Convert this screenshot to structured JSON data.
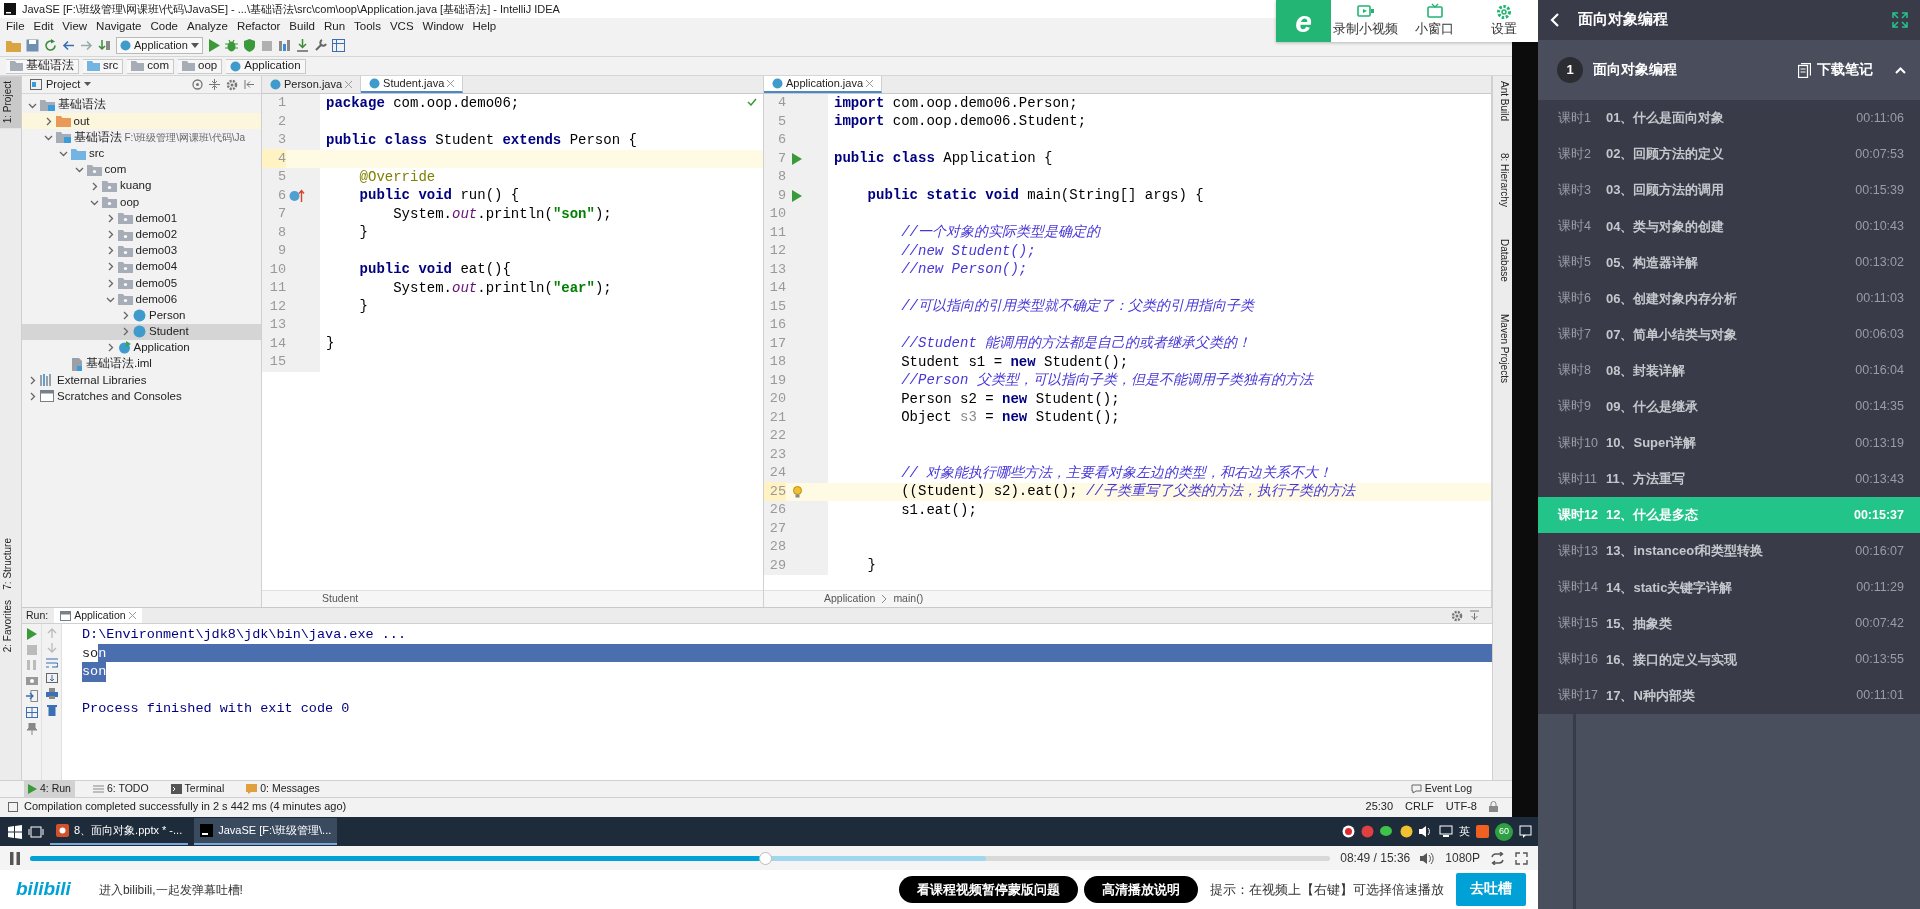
{
  "ide": {
    "title": "JavaSE [F:\\班级管理\\网课班\\代码\\JavaSE] - ...\\基础语法\\src\\com\\oop\\Application.java [基础语法] - IntelliJ IDEA",
    "menu": [
      "File",
      "Edit",
      "View",
      "Navigate",
      "Code",
      "Analyze",
      "Refactor",
      "Build",
      "Run",
      "Tools",
      "VCS",
      "Window",
      "Help"
    ],
    "run_config": "Application",
    "breadcrumb": [
      "基础语法",
      "src",
      "com",
      "oop",
      "Application"
    ],
    "left_tool_tabs": [
      {
        "label": "1: Project",
        "selected": true
      },
      {
        "label": "7: Structure",
        "selected": false
      },
      {
        "label": "2: Favorites",
        "selected": false
      }
    ],
    "right_tool_tabs": [
      "Ant Build",
      "8: Hierarchy",
      "Database",
      "Maven Projects"
    ],
    "project": {
      "title": "Project",
      "tree": [
        {
          "label": "基础语法",
          "kind": "module",
          "expanded": true,
          "selected": false,
          "children": [
            {
              "label": "out",
              "kind": "folder-orange",
              "expanded": false,
              "selected": false,
              "excluded": true
            },
            {
              "label": "基础语法",
              "path": "F:\\班级管理\\网课班\\代码\\Ja",
              "kind": "module",
              "expanded": true,
              "selected": false,
              "children": [
                {
                  "label": "src",
                  "kind": "folder-blue",
                  "expanded": true,
                  "selected": false,
                  "children": [
                    {
                      "label": "com",
                      "kind": "package",
                      "expanded": true,
                      "selected": false,
                      "children": [
                        {
                          "label": "kuang",
                          "kind": "package",
                          "expanded": false,
                          "selected": false
                        },
                        {
                          "label": "oop",
                          "kind": "package",
                          "expanded": true,
                          "selected": false,
                          "children": [
                            {
                              "label": "demo01",
                              "kind": "package",
                              "expanded": false,
                              "selected": false
                            },
                            {
                              "label": "demo02",
                              "kind": "package",
                              "expanded": false,
                              "selected": false
                            },
                            {
                              "label": "demo03",
                              "kind": "package",
                              "expanded": false,
                              "selected": false
                            },
                            {
                              "label": "demo04",
                              "kind": "package",
                              "expanded": false,
                              "selected": false
                            },
                            {
                              "label": "demo05",
                              "kind": "package",
                              "expanded": false,
                              "selected": false
                            },
                            {
                              "label": "demo06",
                              "kind": "package",
                              "expanded": true,
                              "selected": false,
                              "children": [
                                {
                                  "label": "Person",
                                  "kind": "class",
                                  "expanded": false,
                                  "selected": false
                                },
                                {
                                  "label": "Student",
                                  "kind": "class",
                                  "expanded": false,
                                  "selected": true
                                }
                              ]
                            },
                            {
                              "label": "Application",
                              "kind": "main-class",
                              "expanded": false,
                              "selected": false
                            }
                          ]
                        }
                      ]
                    }
                  ]
                },
                {
                  "label": "基础语法.iml",
                  "kind": "iml",
                  "selected": false
                }
              ]
            }
          ]
        },
        {
          "label": "External Libraries",
          "kind": "libraries",
          "expanded": false,
          "selected": false
        },
        {
          "label": "Scratches and Consoles",
          "kind": "scratches",
          "expanded": false,
          "selected": false
        }
      ]
    },
    "editors": [
      {
        "tabs": [
          {
            "label": "Person.java",
            "selected": false
          },
          {
            "label": "Student.java",
            "selected": true
          }
        ],
        "crumbs": [
          "Student"
        ],
        "lines": [
          {
            "no": "1",
            "current": false,
            "tokens": [
              {
                "text": "package",
                "kind": "keyword"
              },
              {
                "text": " com.oop.demo06;"
              }
            ]
          },
          {
            "no": "2",
            "current": false
          },
          {
            "no": "3",
            "current": false,
            "tokens": [
              {
                "text": "public class",
                "kind": "keyword"
              },
              {
                "text": " Student "
              },
              {
                "text": "extends",
                "kind": "keyword"
              },
              {
                "text": " Person {"
              }
            ]
          },
          {
            "no": "4",
            "current": true
          },
          {
            "no": "5",
            "current": false,
            "tokens": [
              {
                "text": "    @Override",
                "kind": "annotation"
              }
            ]
          },
          {
            "no": "6",
            "current": false,
            "gutter": {
              "kind": "override"
            },
            "tokens": [
              {
                "text": "    public void",
                "kind": "keyword"
              },
              {
                "text": " run() {"
              }
            ]
          },
          {
            "no": "7",
            "current": false,
            "tokens": [
              {
                "text": "        System."
              },
              {
                "text": "out",
                "kind": "field"
              },
              {
                "text": ".println("
              },
              {
                "text": "\"son\"",
                "kind": "string"
              },
              {
                "text": ");"
              }
            ]
          },
          {
            "no": "8",
            "current": false,
            "tokens": [
              {
                "text": "    }"
              }
            ]
          },
          {
            "no": "9",
            "current": false
          },
          {
            "no": "10",
            "current": false,
            "tokens": [
              {
                "text": "    public void",
                "kind": "keyword"
              },
              {
                "text": " eat(){"
              }
            ]
          },
          {
            "no": "11",
            "current": false,
            "tokens": [
              {
                "text": "        System."
              },
              {
                "text": "out",
                "kind": "field"
              },
              {
                "text": ".println("
              },
              {
                "text": "\"ear\"",
                "kind": "string"
              },
              {
                "text": ");"
              }
            ]
          },
          {
            "no": "12",
            "current": false,
            "tokens": [
              {
                "text": "    }"
              }
            ]
          },
          {
            "no": "13",
            "current": false
          },
          {
            "no": "14",
            "current": false,
            "tokens": [
              {
                "text": "}"
              }
            ]
          },
          {
            "no": "15",
            "current": false
          }
        ]
      },
      {
        "tabs": [
          {
            "label": "Application.java",
            "selected": true
          }
        ],
        "crumbs": [
          "Application",
          "main()"
        ],
        "lines": [
          {
            "no": "4",
            "current": false,
            "tokens": [
              {
                "text": "import",
                "kind": "keyword"
              },
              {
                "text": " com.oop.demo06.Person;"
              }
            ]
          },
          {
            "no": "5",
            "current": false,
            "tokens": [
              {
                "text": "import",
                "kind": "keyword"
              },
              {
                "text": " com.oop.demo06.Student;"
              }
            ]
          },
          {
            "no": "6",
            "current": false
          },
          {
            "no": "7",
            "current": false,
            "gutter": {
              "kind": "run"
            },
            "tokens": [
              {
                "text": "public class",
                "kind": "keyword"
              },
              {
                "text": " Application {"
              }
            ]
          },
          {
            "no": "8",
            "current": false
          },
          {
            "no": "9",
            "current": false,
            "gutter": {
              "kind": "run"
            },
            "tokens": [
              {
                "text": "    public static void",
                "kind": "keyword"
              },
              {
                "text": " main(String[] args) {"
              }
            ]
          },
          {
            "no": "10",
            "current": false
          },
          {
            "no": "11",
            "current": false,
            "tokens": [
              {
                "text": "        //一个对象的实际类型是确定的",
                "kind": "comment"
              }
            ]
          },
          {
            "no": "12",
            "current": false,
            "tokens": [
              {
                "text": "        //new Student();",
                "kind": "comment"
              }
            ]
          },
          {
            "no": "13",
            "current": false,
            "tokens": [
              {
                "text": "        //new Person();",
                "kind": "comment"
              }
            ]
          },
          {
            "no": "14",
            "current": false
          },
          {
            "no": "15",
            "current": false,
            "tokens": [
              {
                "text": "        //可以指向的引用类型就不确定了：父类的引用指向子类",
                "kind": "comment"
              }
            ]
          },
          {
            "no": "16",
            "current": false
          },
          {
            "no": "17",
            "current": false,
            "tokens": [
              {
                "text": "        //Student 能调用的方法都是自己的或者继承父类的！",
                "kind": "comment"
              }
            ]
          },
          {
            "no": "18",
            "current": false,
            "tokens": [
              {
                "text": "        Student s1 = "
              },
              {
                "text": "new",
                "kind": "keyword"
              },
              {
                "text": " Student();"
              }
            ]
          },
          {
            "no": "19",
            "current": false,
            "tokens": [
              {
                "text": "        //Person 父类型，可以指向子类，但是不能调用子类独有的方法",
                "kind": "comment"
              }
            ]
          },
          {
            "no": "20",
            "current": false,
            "tokens": [
              {
                "text": "        Person s2 = "
              },
              {
                "text": "new",
                "kind": "keyword"
              },
              {
                "text": " Student();"
              }
            ]
          },
          {
            "no": "21",
            "current": false,
            "tokens": [
              {
                "text": "        Object "
              },
              {
                "text": "s3",
                "kind": "unused"
              },
              {
                "text": " = "
              },
              {
                "text": "new",
                "kind": "keyword"
              },
              {
                "text": " Student();"
              }
            ]
          },
          {
            "no": "22",
            "current": false
          },
          {
            "no": "23",
            "current": false
          },
          {
            "no": "24",
            "current": false,
            "tokens": [
              {
                "text": "        // 对象能执行哪些方法，主要看对象左边的类型，和右边关系不大！",
                "kind": "comment"
              }
            ]
          },
          {
            "no": "25",
            "current": true,
            "gutter": {
              "kind": "bulb"
            },
            "tokens": [
              {
                "text": "        ((Student) s2).eat(); "
              },
              {
                "text": "//子类重写了父类的方法，执行子类的方法",
                "kind": "comment"
              }
            ]
          },
          {
            "no": "26",
            "current": false,
            "tokens": [
              {
                "text": "        s1.eat();"
              }
            ]
          },
          {
            "no": "27",
            "current": false
          },
          {
            "no": "28",
            "current": false
          },
          {
            "no": "29",
            "current": false,
            "tokens": [
              {
                "text": "    }"
              }
            ]
          }
        ]
      }
    ],
    "run": {
      "title": "Run:",
      "tab": "Application",
      "output": [
        {
          "kind": "system",
          "row_selected": false,
          "segments": [
            {
              "text": "D:\\Environment\\jdk8\\jdk\\bin\\java.exe ...",
              "selected": false
            }
          ]
        },
        {
          "kind": "stdout",
          "row_selected": true,
          "segments": [
            {
              "text": "so",
              "selected": false
            },
            {
              "text": "n",
              "selected": true
            }
          ]
        },
        {
          "kind": "stdout",
          "row_selected": false,
          "segments": [
            {
              "text": "son",
              "selected": true
            }
          ]
        },
        {
          "kind": "blank"
        },
        {
          "kind": "system",
          "row_selected": false,
          "segments": [
            {
              "text": "Process finished with exit code 0",
              "selected": false
            }
          ]
        }
      ]
    },
    "bottom_tabs": [
      {
        "label": "4: Run",
        "selected": true
      },
      {
        "label": "6: TODO",
        "selected": false
      },
      {
        "label": "Terminal",
        "selected": false
      },
      {
        "label": "0: Messages",
        "selected": false
      }
    ],
    "event_log": "Event Log",
    "status": {
      "message": "Compilation completed successfully in 2 s 442 ms (4 minutes ago)",
      "position": "25:30",
      "line_ending": "CRLF",
      "encoding": "UTF-8"
    }
  },
  "recorder": {
    "logo": "e",
    "items": [
      "录制小视频",
      "小窗口",
      "设置"
    ]
  },
  "taskbar": {
    "apps": [
      {
        "label": "8、面向对象.pptx * -...",
        "selected": false
      },
      {
        "label": "JavaSE [F:\\班级管理\\...",
        "selected": true
      }
    ],
    "ime": "英",
    "badge": "60"
  },
  "player": {
    "playing": true,
    "level": 0.565,
    "buffer": {
      "level": 0.735
    },
    "time": "08:49 / 15:36",
    "quality": "1080P"
  },
  "bottom_bar": {
    "logo": "bilibili",
    "prompt": "进入bilibili,一起发弹幕吐槽!",
    "buttons": [
      "看课程视频暂停蒙版问题",
      "高清播放说明"
    ],
    "hint": "提示：在视频上【右键】可选择倍速播放",
    "send": "去吐槽"
  },
  "sidebar": {
    "title": "面向对象编程",
    "section": {
      "number": "1",
      "title": "面向对象编程",
      "download": "下载笔记",
      "expanded": true
    },
    "lessons": [
      {
        "label": "课时1",
        "title": "01、什么是面向对象",
        "duration": "00:11:06",
        "selected": false
      },
      {
        "label": "课时2",
        "title": "02、回顾方法的定义",
        "duration": "00:07:53",
        "selected": false
      },
      {
        "label": "课时3",
        "title": "03、回顾方法的调用",
        "duration": "00:15:39",
        "selected": false
      },
      {
        "label": "课时4",
        "title": "04、类与对象的创建",
        "duration": "00:10:43",
        "selected": false
      },
      {
        "label": "课时5",
        "title": "05、构造器详解",
        "duration": "00:13:02",
        "selected": false
      },
      {
        "label": "课时6",
        "title": "06、创建对象内存分析",
        "duration": "00:11:03",
        "selected": false
      },
      {
        "label": "课时7",
        "title": "07、简单小结类与对象",
        "duration": "00:06:03",
        "selected": false
      },
      {
        "label": "课时8",
        "title": "08、封装详解",
        "duration": "00:16:04",
        "selected": false
      },
      {
        "label": "课时9",
        "title": "09、什么是继承",
        "duration": "00:14:35",
        "selected": false
      },
      {
        "label": "课时10",
        "title": "10、Super详解",
        "duration": "00:13:19",
        "selected": false
      },
      {
        "label": "课时11",
        "title": "11、方法重写",
        "duration": "00:13:43",
        "selected": false
      },
      {
        "label": "课时12",
        "title": "12、什么是多态",
        "duration": "00:15:37",
        "selected": true
      },
      {
        "label": "课时13",
        "title": "13、instanceof和类型转换",
        "duration": "00:16:07",
        "selected": false
      },
      {
        "label": "课时14",
        "title": "14、static关键字详解",
        "duration": "00:11:29",
        "selected": false
      },
      {
        "label": "课时15",
        "title": "15、抽象类",
        "duration": "00:07:42",
        "selected": false
      },
      {
        "label": "课时16",
        "title": "16、接口的定义与实现",
        "duration": "00:13:55",
        "selected": false
      },
      {
        "label": "课时17",
        "title": "17、N种内部类",
        "duration": "00:11:01",
        "selected": false
      }
    ]
  }
}
